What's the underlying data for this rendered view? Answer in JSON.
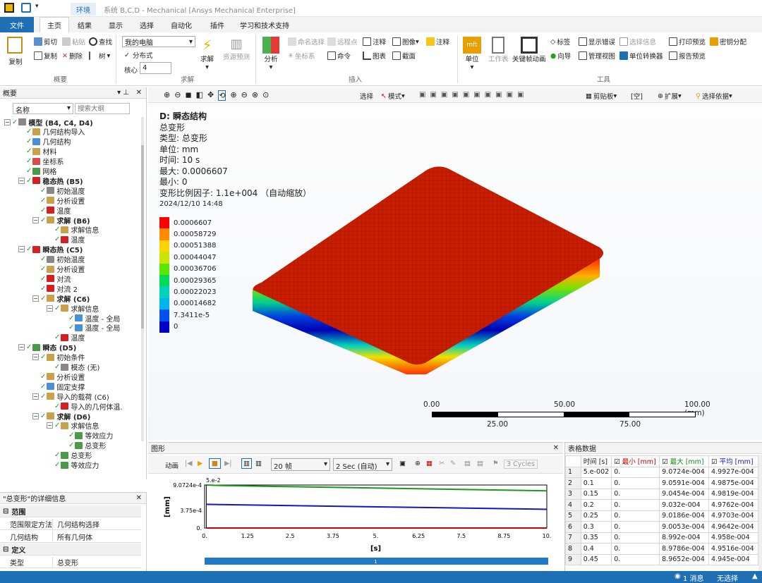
{
  "window": {
    "title": "系统 B,C,D - Mechanical [Ansys Mechanical Enterprise]",
    "env_tab": "环境"
  },
  "ribbon_tabs": [
    "文件",
    "主页",
    "结果",
    "显示",
    "选择",
    "自动化",
    "插件",
    "学习和技术支持"
  ],
  "ribbon": {
    "clipboard": {
      "paste": "复制",
      "cut": "剪切",
      "copy": "复制",
      "delete": "删除",
      "paste2": "粘贴",
      "find": "查找",
      "tree": "树",
      "group": "概要"
    },
    "solve": {
      "computer": "我的电脑",
      "distributed": "分布式",
      "cores_label": "核心",
      "cores_value": "4",
      "solve_btn": "求解",
      "resource": "资源预测",
      "group": "求解"
    },
    "insert": {
      "analysis": "分析",
      "named_sel": "命名选择",
      "remote_pt": "远程点",
      "annotation": "注释",
      "image": "图像",
      "comment": "注释",
      "coord": "坐标系",
      "command": "命令",
      "chart": "图表",
      "section": "截面",
      "group": "插入"
    },
    "tools": {
      "units": "单位",
      "worksheet": "工作表",
      "keyframe": "关键帧动画",
      "tags": "标签",
      "show_err": "显示错误",
      "sel_info": "选择信息",
      "print": "打印预览",
      "key": "密钥分配",
      "wizard": "向导",
      "manage": "管理视图",
      "unit_conv": "单位转换器",
      "report": "报告预览",
      "group": "工具"
    }
  },
  "outline": {
    "title": "概要",
    "search_placeholder": "搜索大纲",
    "name_label": "名称",
    "items": [
      {
        "label": "模型 (B4, C4, D4)",
        "level": 0,
        "bold": true,
        "color": "#888"
      },
      {
        "label": "几何结构导入",
        "level": 1,
        "color": "#c9a14a"
      },
      {
        "label": "几何结构",
        "level": 1,
        "color": "#4a90d9"
      },
      {
        "label": "材料",
        "level": 1,
        "color": "#c9a14a"
      },
      {
        "label": "坐标系",
        "level": 1,
        "color": "#d94a4a"
      },
      {
        "label": "网格",
        "level": 1,
        "color": "#4a9a4a"
      },
      {
        "label": "稳态热 (B5)",
        "level": 1,
        "bold": true,
        "color": "#d42020"
      },
      {
        "label": "初始温度",
        "level": 2,
        "color": "#888"
      },
      {
        "label": "分析设置",
        "level": 2,
        "color": "#c9a14a"
      },
      {
        "label": "温度",
        "level": 2,
        "color": "#d42020"
      },
      {
        "label": "求解 (B6)",
        "level": 2,
        "bold": true,
        "color": "#c9a14a"
      },
      {
        "label": "求解信息",
        "level": 3,
        "color": "#c9a14a"
      },
      {
        "label": "温度",
        "level": 3,
        "color": "#d42020"
      },
      {
        "label": "瞬态热 (C5)",
        "level": 1,
        "bold": true,
        "color": "#d42020"
      },
      {
        "label": "初始温度",
        "level": 2,
        "color": "#888"
      },
      {
        "label": "分析设置",
        "level": 2,
        "color": "#c9a14a"
      },
      {
        "label": "对流",
        "level": 2,
        "color": "#d42020"
      },
      {
        "label": "对流 2",
        "level": 2,
        "color": "#d42020"
      },
      {
        "label": "求解 (C6)",
        "level": 2,
        "bold": true,
        "color": "#c9a14a"
      },
      {
        "label": "求解信息",
        "level": 3,
        "color": "#c9a14a"
      },
      {
        "label": "温度 - 全局",
        "level": 4,
        "color": "#4a90d9"
      },
      {
        "label": "温度 - 全局",
        "level": 4,
        "color": "#4a90d9"
      },
      {
        "label": "温度",
        "level": 3,
        "color": "#d42020"
      },
      {
        "label": "瞬态 (D5)",
        "level": 1,
        "bold": true,
        "color": "#4a9a4a"
      },
      {
        "label": "初始条件",
        "level": 2,
        "color": "#c9a14a"
      },
      {
        "label": "模态 (无)",
        "level": 3,
        "color": "#888"
      },
      {
        "label": "分析设置",
        "level": 2,
        "color": "#c9a14a"
      },
      {
        "label": "固定支撑",
        "level": 2,
        "color": "#4a90d9"
      },
      {
        "label": "导入的载荷 (C6)",
        "level": 2,
        "color": "#c9a14a"
      },
      {
        "label": "导入的几何体温.",
        "level": 3,
        "color": "#d42020"
      },
      {
        "label": "求解 (D6)",
        "level": 2,
        "bold": true,
        "color": "#c9a14a"
      },
      {
        "label": "求解信息",
        "level": 3,
        "color": "#c9a14a"
      },
      {
        "label": "等效应力",
        "level": 4,
        "color": "#4a9a4a"
      },
      {
        "label": "总变形",
        "level": 4,
        "color": "#4a9a4a"
      },
      {
        "label": "总变形",
        "level": 3,
        "color": "#4a9a4a"
      },
      {
        "label": "等效应力",
        "level": 3,
        "color": "#4a9a4a"
      }
    ]
  },
  "details": {
    "title": "\"总变形\"的详细信息",
    "sections": [
      {
        "name": "范围",
        "rows": [
          [
            "范围限定方法",
            "几何结构选择"
          ],
          [
            "几何结构",
            "所有几何体"
          ]
        ]
      },
      {
        "name": "定义",
        "rows": [
          [
            "类型",
            "总变形"
          ]
        ]
      }
    ]
  },
  "graphics_toolbar": {
    "select": "选择",
    "mode": "模式",
    "clipboard": "剪贴板",
    "empty": "[空]",
    "expand": "扩展",
    "select_by": "选择依据"
  },
  "viewport": {
    "info": {
      "line1": "D: 瞬态结构",
      "line2": "总变形",
      "line3": "类型: 总变形",
      "line4": "单位: mm",
      "line5": "时间: 10 s",
      "line6": "最大: 0.0006607",
      "line7": "最小: 0",
      "line8": "变形比例因子: 1.1e+004 （自动缩放）",
      "line9": "2024/12/10 14:48"
    },
    "legend": {
      "values": [
        "0.0006607",
        "0.00058729",
        "0.00051388",
        "0.00044047",
        "0.00036706",
        "0.00029365",
        "0.00022023",
        "0.00014682",
        "7.3411e-5",
        "0"
      ],
      "colors": [
        "#ff0000",
        "#ff8c00",
        "#ffd400",
        "#c8e600",
        "#5ae600",
        "#00dc5a",
        "#00d2be",
        "#00b4f0",
        "#0050f0",
        "#0000c8"
      ]
    },
    "scale": {
      "top": [
        "0.00",
        "50.00",
        "100.00 (mm)"
      ],
      "bottom": [
        "25.00",
        "75.00"
      ]
    }
  },
  "graph_panel": {
    "title": "图形",
    "animation": "动画",
    "frames": "20 帧",
    "duration": "2 Sec (自动)",
    "cycles": "3 Cycles",
    "y_label": "[mm]",
    "x_label": "[s]",
    "top_label": "5.e-2",
    "y_ticks": [
      "9.0724e-4",
      "3.75e-4",
      "0."
    ],
    "x_ticks": [
      "0.",
      "1.25",
      "2.5",
      "3.75",
      "5.",
      "6.25",
      "7.5",
      "8.75",
      "10."
    ],
    "bar_label": "1"
  },
  "chart_data": {
    "type": "line",
    "x": [
      0.05,
      0.1,
      0.15,
      0.2,
      0.25,
      0.3,
      0.35,
      0.4,
      0.45,
      10
    ],
    "ylim": [
      0,
      0.00090724
    ],
    "xlim": [
      0,
      10
    ],
    "series": [
      {
        "name": "最大 [mm]",
        "color": "#1a9a1a",
        "values": [
          0.00090724,
          0.00090591,
          0.00090454,
          0.0009032,
          0.00090186,
          0.00090053,
          0.0008992,
          0.00089786,
          0.00089652,
          0.000785
        ]
      },
      {
        "name": "平均 [mm]",
        "color": "#1515c8",
        "values": [
          0.00049927,
          0.00049875,
          0.00049819,
          0.00049762,
          0.00049703,
          0.00049642,
          0.0004958,
          0.00049516,
          0.0004945,
          0.000395
        ]
      },
      {
        "name": "最小 [mm]",
        "color": "#cc0000",
        "values": [
          0,
          0,
          0,
          0,
          0,
          0,
          0,
          0,
          0,
          0
        ]
      }
    ]
  },
  "table_panel": {
    "title": "表格数据",
    "headers": [
      "",
      "时间 [s]",
      "最小 [mm]",
      "最大 [mm]",
      "平均 [mm]"
    ],
    "rows": [
      [
        "1",
        "5.e-002",
        "0.",
        "9.0724e-004",
        "4.9927e-004"
      ],
      [
        "2",
        "0.1",
        "0.",
        "9.0591e-004",
        "4.9875e-004"
      ],
      [
        "3",
        "0.15",
        "0.",
        "9.0454e-004",
        "4.9819e-004"
      ],
      [
        "4",
        "0.2",
        "0.",
        "9.032e-004",
        "4.9762e-004"
      ],
      [
        "5",
        "0.25",
        "0.",
        "9.0186e-004",
        "4.9703e-004"
      ],
      [
        "6",
        "0.3",
        "0.",
        "9.0053e-004",
        "4.9642e-004"
      ],
      [
        "7",
        "0.35",
        "0.",
        "8.992e-004",
        "4.958e-004"
      ],
      [
        "8",
        "0.4",
        "0.",
        "8.9786e-004",
        "4.9516e-004"
      ],
      [
        "9",
        "0.45",
        "0.",
        "8.9652e-004",
        "4.945e-004"
      ]
    ]
  },
  "status": {
    "messages": "1 消息",
    "selection": "无选择"
  }
}
